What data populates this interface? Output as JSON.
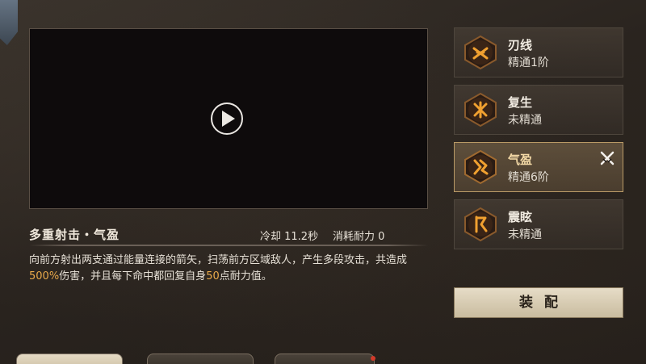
{
  "video": {
    "play_icon": "play-circle-icon"
  },
  "skill": {
    "title": "多重射击・气盈",
    "cooldown": "冷却 11.2秒",
    "cost": "消耗耐力 0",
    "desc_part1": "向前方射出两支通过能量连接的箭矢，扫荡前方区域敌人，产生多段攻击，共造成",
    "desc_hl1": "500%",
    "desc_part2": "伤害，并且每下命中都回复自身",
    "desc_hl2": "50",
    "desc_part3": "点耐力值。"
  },
  "variants": [
    {
      "name": "刃线",
      "status": "精通1阶",
      "icon": "blade-rune-icon",
      "selected": false
    },
    {
      "name": "复生",
      "status": "未精通",
      "icon": "revive-rune-icon",
      "selected": false
    },
    {
      "name": "气盈",
      "status": "精通6阶",
      "icon": "spirit-rune-icon",
      "selected": true,
      "equipped_icon": "crossed-swords-icon"
    },
    {
      "name": "震眩",
      "status": "未精通",
      "icon": "stun-rune-icon",
      "selected": false
    }
  ],
  "equip_button": "装配",
  "bottom_tabs": [
    {
      "label": "",
      "active": true
    },
    {
      "label": "",
      "active": false
    },
    {
      "label": "",
      "active": false,
      "badge": true
    }
  ],
  "colors": {
    "highlight": "#e8a94a",
    "rune_glow": "#f0a030",
    "selected_border": "#b99a66"
  }
}
